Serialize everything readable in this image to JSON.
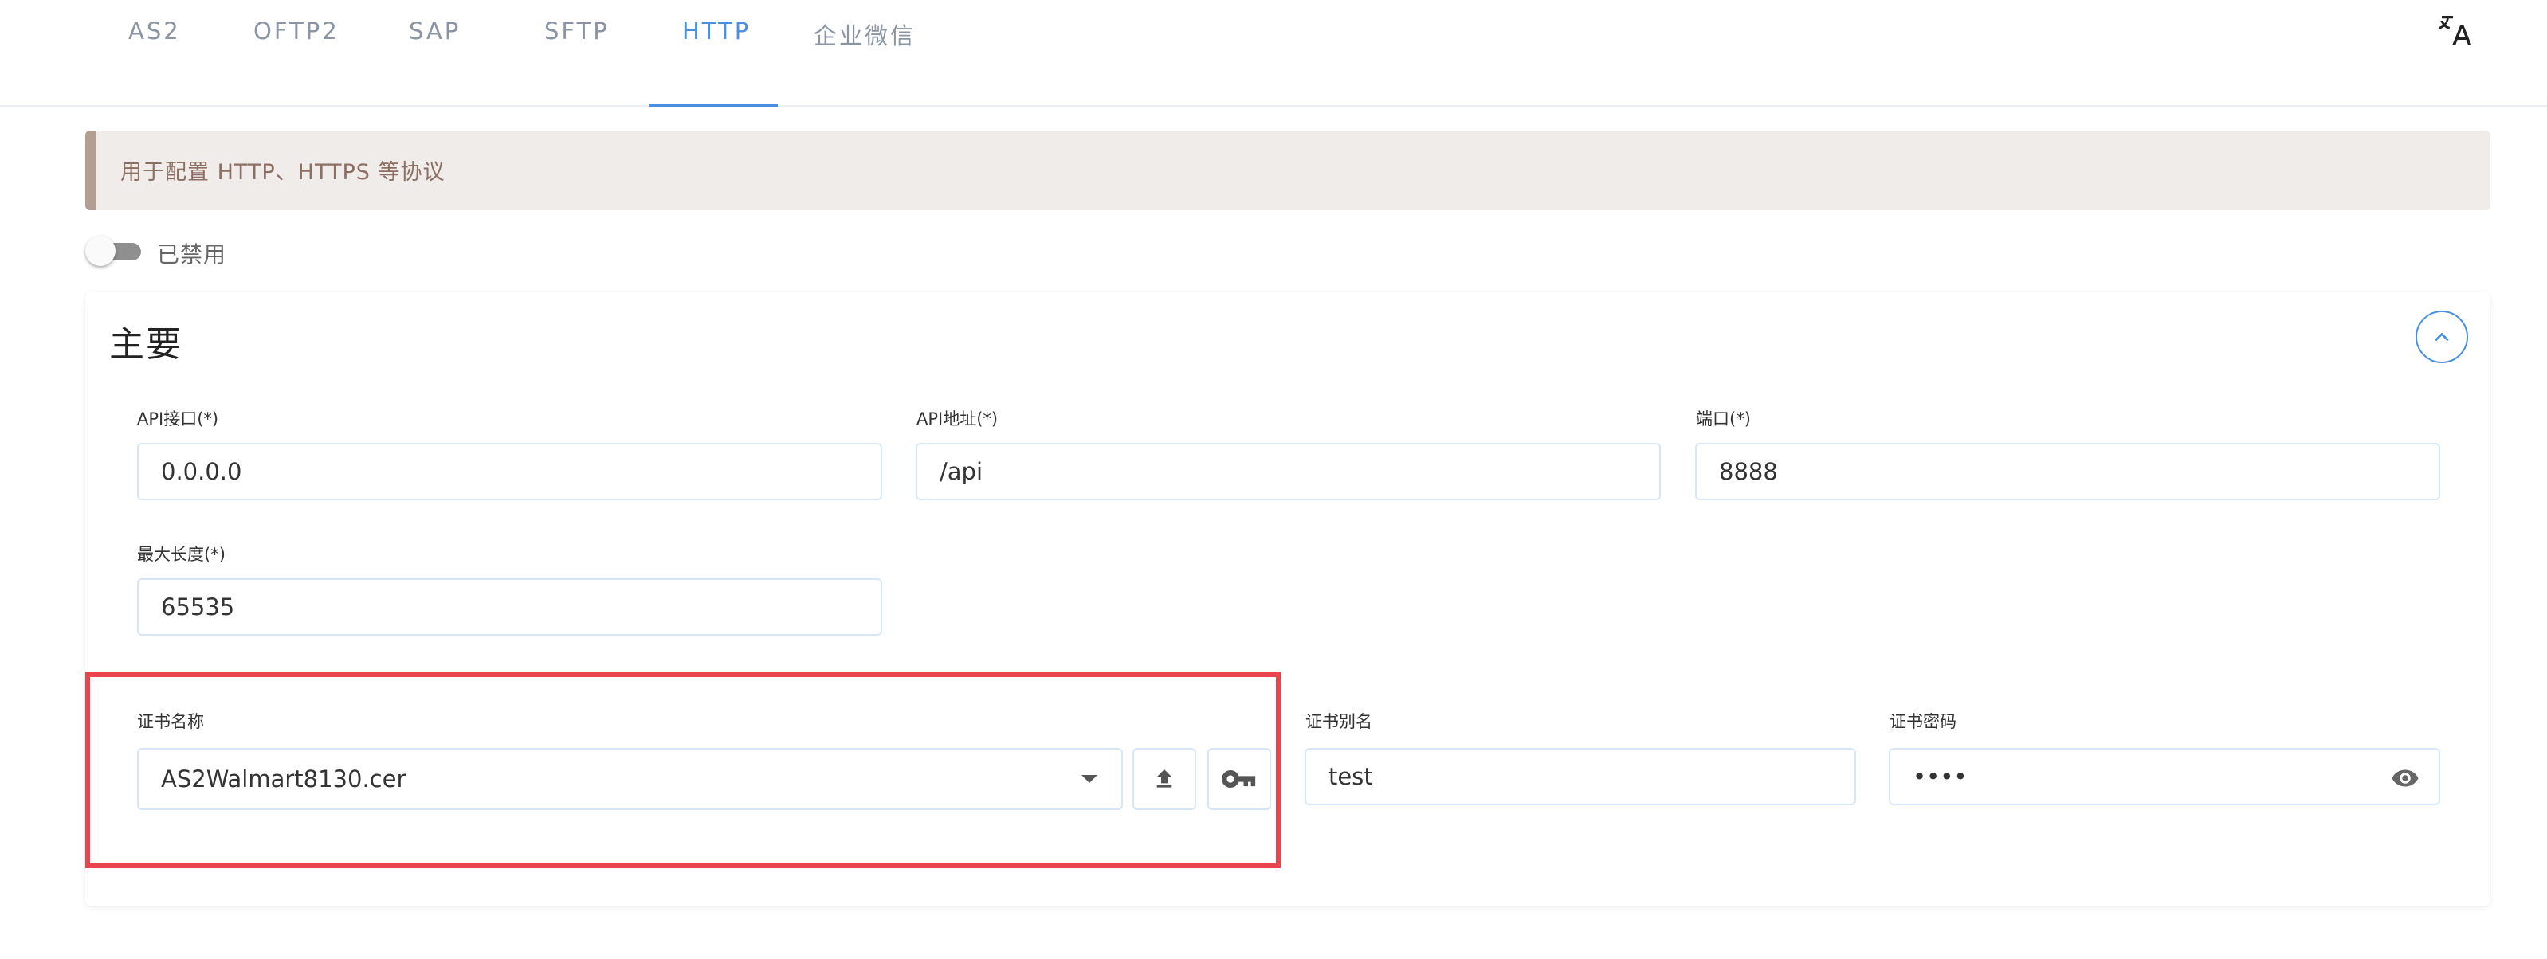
{
  "tabs": [
    {
      "label": "AS2"
    },
    {
      "label": "OFTP2"
    },
    {
      "label": "SAP"
    },
    {
      "label": "SFTP"
    },
    {
      "label": "HTTP",
      "active": true
    },
    {
      "label": "企业微信"
    }
  ],
  "colors": {
    "accent": "#4a90e2",
    "banner_bg": "#f0ecea",
    "banner_text": "#8c6e62",
    "highlight": "#e8464c"
  },
  "banner": {
    "text": "用于配置 HTTP、HTTPS 等协议"
  },
  "toggle": {
    "label": "已禁用",
    "enabled": false
  },
  "card": {
    "title": "主要",
    "collapse_icon": "chevron-up-icon",
    "fields": {
      "api_interface": {
        "label": "API接口(*)",
        "value": "0.0.0.0"
      },
      "api_address": {
        "label": "API地址(*)",
        "value": "/api"
      },
      "port": {
        "label": "端口(*)",
        "value": "8888"
      },
      "max_length": {
        "label": "最大长度(*)",
        "value": "65535"
      },
      "cert_name": {
        "label": "证书名称",
        "value": "AS2Walmart8130.cer"
      },
      "cert_alias": {
        "label": "证书别名",
        "value": "test"
      },
      "cert_password": {
        "label": "证书密码",
        "value": "••••"
      }
    }
  },
  "icons": {
    "translate": "translate-icon",
    "upload": "upload-icon",
    "key": "key-icon",
    "eye": "eye-icon",
    "dropdown": "caret-down-icon"
  }
}
